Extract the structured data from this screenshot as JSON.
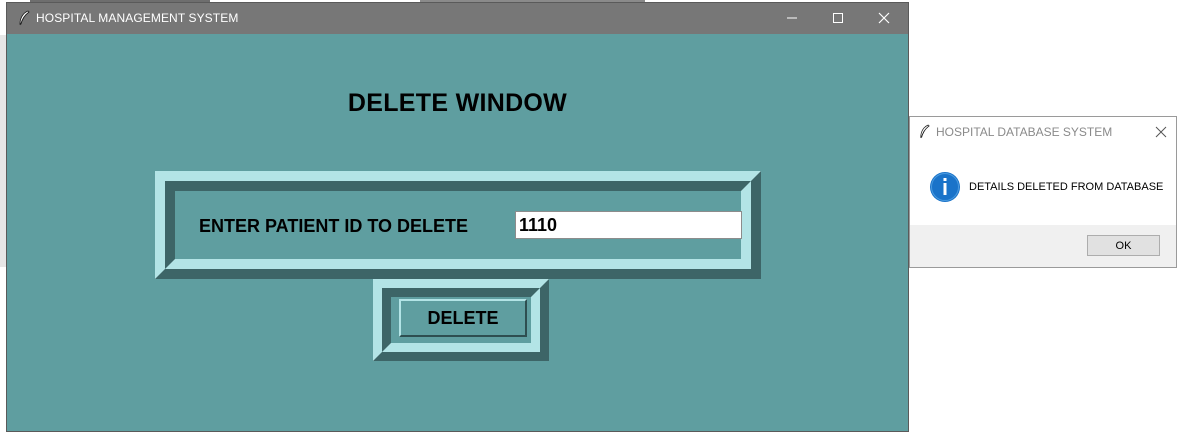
{
  "main_window": {
    "title": "HOSPITAL MANAGEMENT SYSTEM",
    "heading": "DELETE WINDOW",
    "patient_id_label": "ENTER PATIENT ID TO DELETE",
    "patient_id_value": "1110",
    "delete_button": "DELETE",
    "colors": {
      "background": "#5f9ea0",
      "titlebar": "#777777",
      "ridge_light": "#b3e4e6",
      "ridge_dark": "#3d6567"
    }
  },
  "dialog": {
    "title": "HOSPITAL DATABASE SYSTEM",
    "icon": "info-icon",
    "message": "DETAILS DELETED FROM DATABASE",
    "ok_button": "OK"
  }
}
